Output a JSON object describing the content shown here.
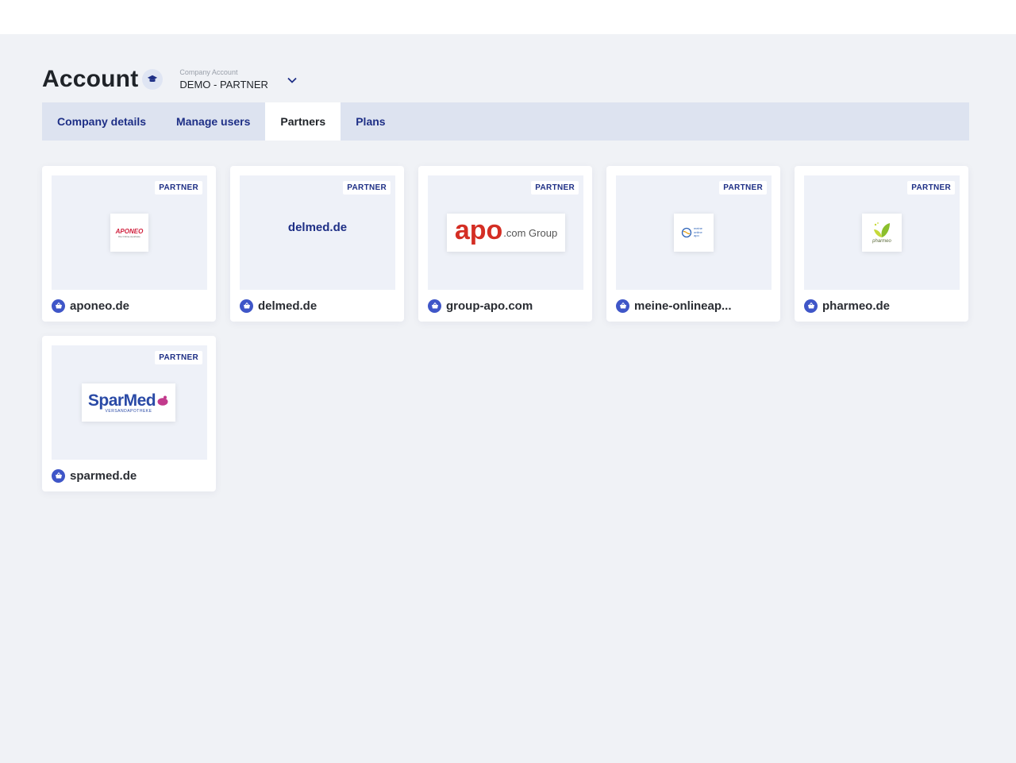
{
  "header": {
    "title": "Account",
    "title_icon": "graduation-cap-icon",
    "company_label": "Company Account",
    "company_value": "DEMO - PARTNER"
  },
  "tabs": [
    {
      "label": "Company details",
      "active": false
    },
    {
      "label": "Manage users",
      "active": false
    },
    {
      "label": "Partners",
      "active": true
    },
    {
      "label": "Plans",
      "active": false
    }
  ],
  "partners": [
    {
      "name": "aponeo.de",
      "badge": "PARTNER",
      "logo_text": "APONEO",
      "logo_sub": "Die Online-Apotheke"
    },
    {
      "name": "delmed.de",
      "badge": "PARTNER",
      "logo_text": "delmed.de"
    },
    {
      "name": "group-apo.com",
      "badge": "PARTNER",
      "logo_text": "apo",
      "logo_sub": ".com Group"
    },
    {
      "name": "meine-onlineap...",
      "badge": "PARTNER",
      "logo_text": "meine online apo"
    },
    {
      "name": "pharmeo.de",
      "badge": "PARTNER",
      "logo_text": "pharmeo"
    },
    {
      "name": "sparmed.de",
      "badge": "PARTNER",
      "logo_text": "SparMed",
      "logo_sub": "VERSANDAPOTHEKE"
    }
  ],
  "colors": {
    "accent": "#1e2f86",
    "icon_blue": "#3f56c8",
    "background": "#f0f2f6",
    "tabbar": "#dde3f0"
  }
}
